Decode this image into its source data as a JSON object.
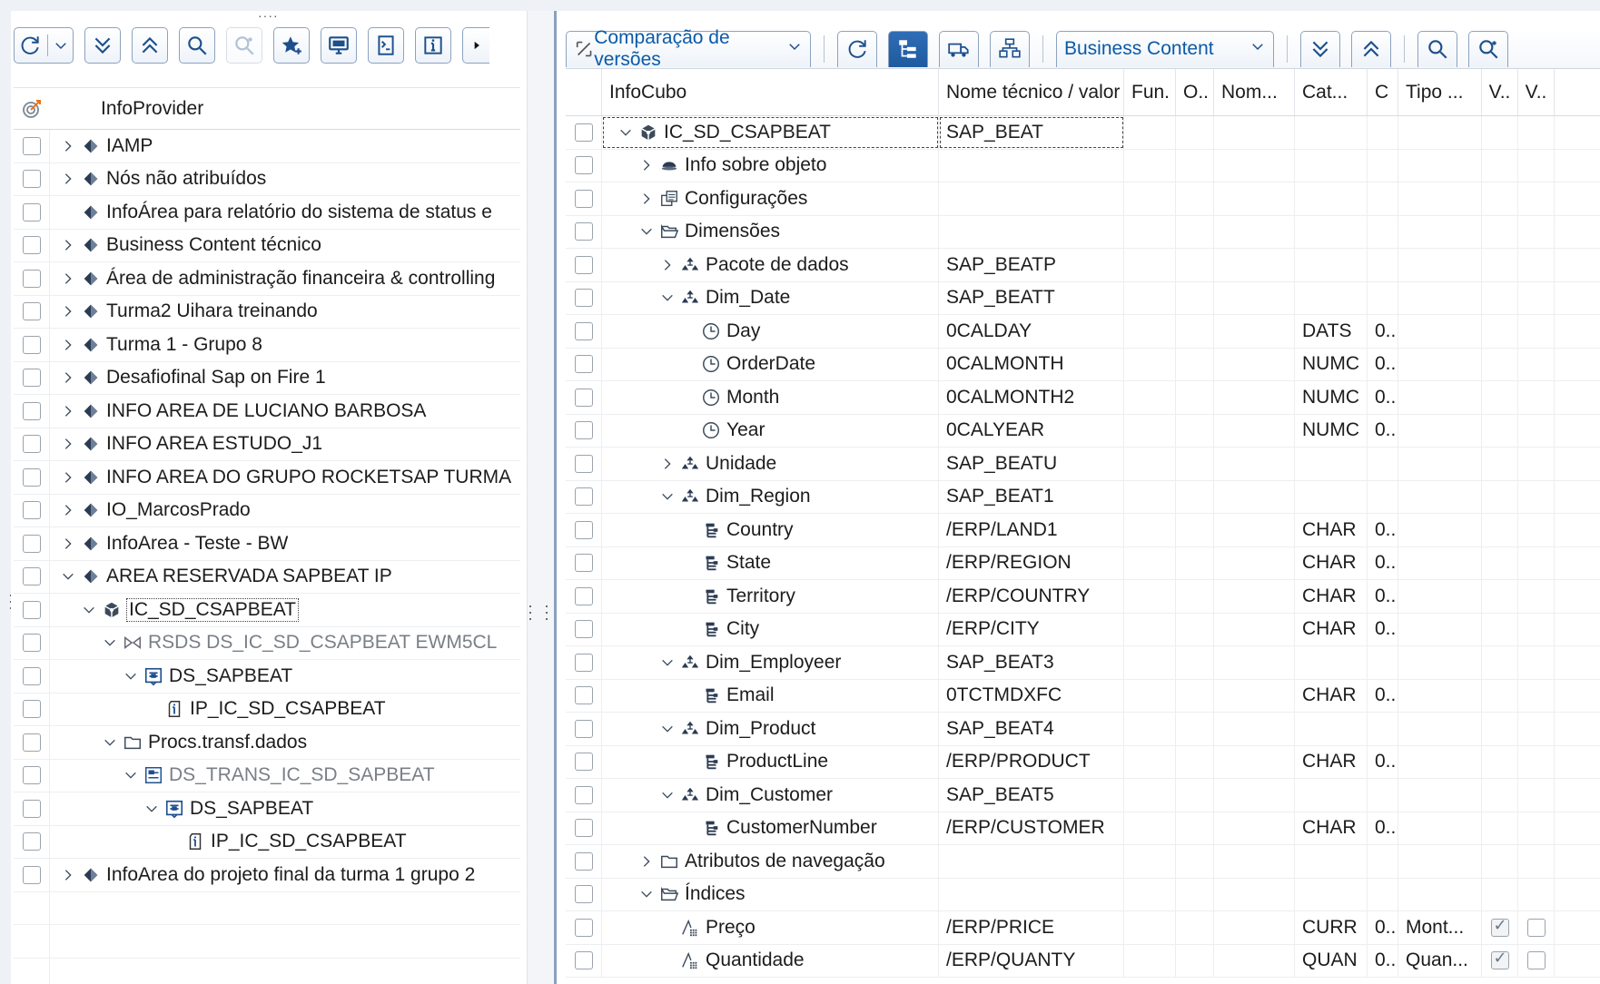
{
  "left": {
    "toolbar": {
      "refresh": "refresh-icon",
      "dropdown": "chevron-down-icon",
      "expand_all": "expand-all-icon",
      "collapse_all": "collapse-all-icon",
      "search": "search-icon",
      "search_next": "search-next-icon",
      "favorite": "favorite-icon",
      "display": "monitor-icon",
      "filter": "filter-icon",
      "info": "info-icon",
      "more": "more-icon"
    },
    "header": {
      "title": "InfoProvider"
    },
    "rows": [
      {
        "label": "IAMP",
        "expand": "collapsed",
        "icon": "infoarea",
        "indent": 0
      },
      {
        "label": "Nós não atribuídos",
        "expand": "collapsed",
        "icon": "infoarea",
        "indent": 0
      },
      {
        "label": "InfoÁrea para relatório do sistema de status e",
        "expand": "none",
        "icon": "infoarea",
        "indent": 0
      },
      {
        "label": "Business Content técnico",
        "expand": "collapsed",
        "icon": "infoarea",
        "indent": 0
      },
      {
        "label": "Área de administração financeira & controlling",
        "expand": "collapsed",
        "icon": "infoarea",
        "indent": 0
      },
      {
        "label": "Turma2 Uihara treinando",
        "expand": "collapsed",
        "icon": "infoarea",
        "indent": 0
      },
      {
        "label": "Turma 1 - Grupo 8",
        "expand": "collapsed",
        "icon": "infoarea",
        "indent": 0
      },
      {
        "label": "Desafiofinal Sap on Fire 1",
        "expand": "collapsed",
        "icon": "infoarea",
        "indent": 0
      },
      {
        "label": "INFO AREA  DE LUCIANO BARBOSA",
        "expand": "collapsed",
        "icon": "infoarea",
        "indent": 0
      },
      {
        "label": "INFO AREA ESTUDO_J1",
        "expand": "collapsed",
        "icon": "infoarea",
        "indent": 0
      },
      {
        "label": "INFO AREA DO GRUPO ROCKETSAP TURMA",
        "expand": "collapsed",
        "icon": "infoarea",
        "indent": 0
      },
      {
        "label": "IO_MarcosPrado",
        "expand": "collapsed",
        "icon": "infoarea",
        "indent": 0
      },
      {
        "label": "InfoArea - Teste - BW",
        "expand": "collapsed",
        "icon": "infoarea",
        "indent": 0
      },
      {
        "label": "AREA RESERVADA SAPBEAT IP",
        "expand": "expanded",
        "icon": "infoarea",
        "indent": 0
      },
      {
        "label": "IC_SD_CSAPBEAT",
        "expand": "expanded",
        "icon": "cube",
        "indent": 1,
        "focus": true
      },
      {
        "label": "RSDS DS_IC_SD_CSAPBEAT EWM5CL",
        "expand": "expanded",
        "icon": "transform",
        "indent": 2,
        "grey": true
      },
      {
        "label": "DS_SAPBEAT",
        "expand": "expanded",
        "icon": "datasource",
        "indent": 3
      },
      {
        "label": "IP_IC_SD_CSAPBEAT",
        "expand": "none",
        "icon": "infopackage",
        "indent": 4
      },
      {
        "label": "Procs.transf.dados",
        "expand": "expanded",
        "icon": "folder",
        "indent": 2
      },
      {
        "label": "DS_TRANS_IC_SD_SAPBEAT",
        "expand": "expanded",
        "icon": "dtp",
        "indent": 3,
        "grey": true
      },
      {
        "label": "DS_SAPBEAT",
        "expand": "expanded",
        "icon": "datasource",
        "indent": 4
      },
      {
        "label": "IP_IC_SD_CSAPBEAT",
        "expand": "none",
        "icon": "infopackage",
        "indent": 5
      },
      {
        "label": "InfoArea do projeto final da turma 1 grupo 2",
        "expand": "collapsed",
        "icon": "infoarea",
        "indent": 0
      }
    ]
  },
  "right": {
    "toolbar": {
      "compare_label": "Comparação de versões",
      "business_content_label": "Business Content"
    },
    "columns": [
      "InfoCubo",
      "Nome técnico / valor",
      "Fun.",
      "O..",
      "Nom...",
      "Cat...",
      "C",
      "Tipo ...",
      "V..",
      "V.."
    ],
    "rows": [
      {
        "name": "IC_SD_CSAPBEAT",
        "tech": "SAP_BEAT",
        "expand": "expanded",
        "icon": "cube",
        "indent": 0,
        "focus": true
      },
      {
        "name": "Info sobre objeto",
        "tech": "",
        "expand": "collapsed",
        "icon": "info-object",
        "indent": 1
      },
      {
        "name": "Configurações",
        "tech": "",
        "expand": "collapsed",
        "icon": "settings",
        "indent": 1
      },
      {
        "name": "Dimensões",
        "tech": "",
        "expand": "expanded",
        "icon": "folder-open",
        "indent": 1
      },
      {
        "name": "Pacote de dados",
        "tech": "SAP_BEATP",
        "expand": "collapsed",
        "icon": "dimension",
        "indent": 2
      },
      {
        "name": "Dim_Date",
        "tech": "SAP_BEATT",
        "expand": "expanded",
        "icon": "dimension",
        "indent": 2
      },
      {
        "name": "Day",
        "tech": "0CALDAY",
        "expand": "none",
        "icon": "clock",
        "indent": 3,
        "cat": "DATS",
        "c": "0..."
      },
      {
        "name": "OrderDate",
        "tech": "0CALMONTH",
        "expand": "none",
        "icon": "clock",
        "indent": 3,
        "cat": "NUMC",
        "c": "0..."
      },
      {
        "name": "Month",
        "tech": "0CALMONTH2",
        "expand": "none",
        "icon": "clock",
        "indent": 3,
        "cat": "NUMC",
        "c": "0..."
      },
      {
        "name": "Year",
        "tech": "0CALYEAR",
        "expand": "none",
        "icon": "clock",
        "indent": 3,
        "cat": "NUMC",
        "c": "0..."
      },
      {
        "name": "Unidade",
        "tech": "SAP_BEATU",
        "expand": "collapsed",
        "icon": "dimension",
        "indent": 2
      },
      {
        "name": "Dim_Region",
        "tech": "SAP_BEAT1",
        "expand": "expanded",
        "icon": "dimension",
        "indent": 2
      },
      {
        "name": "Country",
        "tech": "/ERP/LAND1",
        "expand": "none",
        "icon": "characteristic",
        "indent": 3,
        "cat": "CHAR",
        "c": "0..."
      },
      {
        "name": "State",
        "tech": "/ERP/REGION",
        "expand": "none",
        "icon": "characteristic",
        "indent": 3,
        "cat": "CHAR",
        "c": "0..."
      },
      {
        "name": "Territory",
        "tech": "/ERP/COUNTRY",
        "expand": "none",
        "icon": "characteristic",
        "indent": 3,
        "cat": "CHAR",
        "c": "0..."
      },
      {
        "name": "City",
        "tech": "/ERP/CITY",
        "expand": "none",
        "icon": "characteristic",
        "indent": 3,
        "cat": "CHAR",
        "c": "0..."
      },
      {
        "name": "Dim_Employeer",
        "tech": "SAP_BEAT3",
        "expand": "expanded",
        "icon": "dimension",
        "indent": 2
      },
      {
        "name": "Email",
        "tech": "0TCTMDXFC",
        "expand": "none",
        "icon": "characteristic",
        "indent": 3,
        "cat": "CHAR",
        "c": "0..."
      },
      {
        "name": "Dim_Product",
        "tech": "SAP_BEAT4",
        "expand": "expanded",
        "icon": "dimension",
        "indent": 2
      },
      {
        "name": "ProductLine",
        "tech": "/ERP/PRODUCT",
        "expand": "none",
        "icon": "characteristic",
        "indent": 3,
        "cat": "CHAR",
        "c": "0..."
      },
      {
        "name": "Dim_Customer",
        "tech": "SAP_BEAT5",
        "expand": "expanded",
        "icon": "dimension",
        "indent": 2
      },
      {
        "name": "CustomerNumber",
        "tech": "/ERP/CUSTOMER",
        "expand": "none",
        "icon": "characteristic",
        "indent": 3,
        "cat": "CHAR",
        "c": "0..."
      },
      {
        "name": "Atributos de navegação",
        "tech": "",
        "expand": "collapsed",
        "icon": "folder",
        "indent": 1
      },
      {
        "name": "Índices",
        "tech": "",
        "expand": "expanded",
        "icon": "folder-open",
        "indent": 1
      },
      {
        "name": "Preço",
        "tech": "/ERP/PRICE",
        "expand": "none",
        "icon": "keyfigure",
        "indent": 2,
        "cat": "CURR",
        "c": "0...",
        "tipo": "Mont...",
        "v1": true,
        "v2": false
      },
      {
        "name": "Quantidade",
        "tech": "/ERP/QUANTY",
        "expand": "none",
        "icon": "keyfigure",
        "indent": 2,
        "cat": "QUAN",
        "c": "0...",
        "tipo": "Quan...",
        "v1": true,
        "v2": false
      }
    ]
  },
  "colors": {
    "accent": "#0a5aa8",
    "active_button": "#2466ad",
    "border": "#8da2bf"
  }
}
